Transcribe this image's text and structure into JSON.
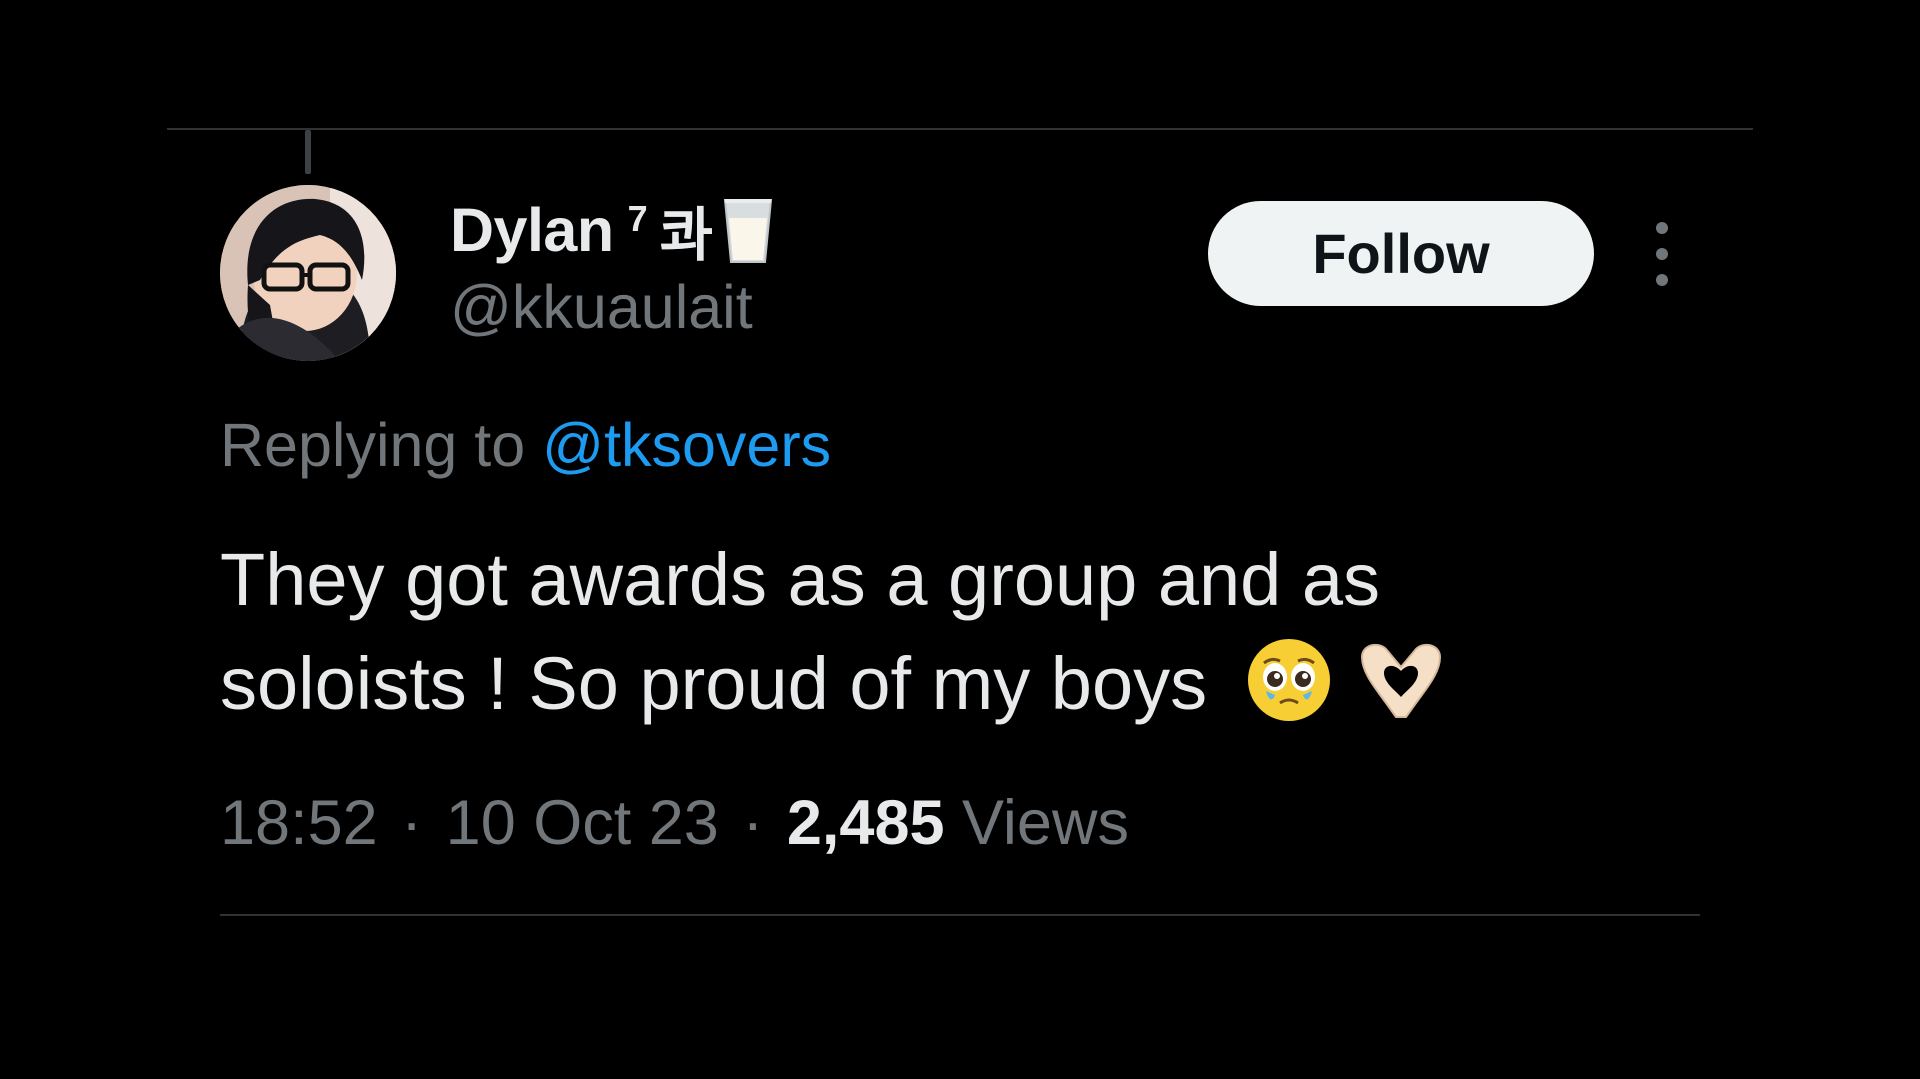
{
  "tweet": {
    "author": {
      "display_name": "Dylan",
      "name_superscript": "7",
      "name_korean": "콰",
      "name_emoji": "milk-glass-icon",
      "handle": "@kkuaulait"
    },
    "follow_label": "Follow",
    "reply": {
      "prefix": "Replying to",
      "mention": "@tksovers"
    },
    "text_line1": "They got awards as a group and as",
    "text_line2": "soloists ! So proud of my boys",
    "emojis": [
      "pleading-face-icon",
      "heart-hands-icon"
    ],
    "meta": {
      "time": "18:52",
      "date": "10 Oct 23",
      "views_count": "2,485",
      "views_label": "Views",
      "separator": "·"
    }
  },
  "colors": {
    "background": "#000000",
    "primary_text": "#e7e9ea",
    "secondary_text": "#71767b",
    "link": "#1d9bf0",
    "divider": "#2f3336",
    "button_bg": "#eff3f4"
  }
}
